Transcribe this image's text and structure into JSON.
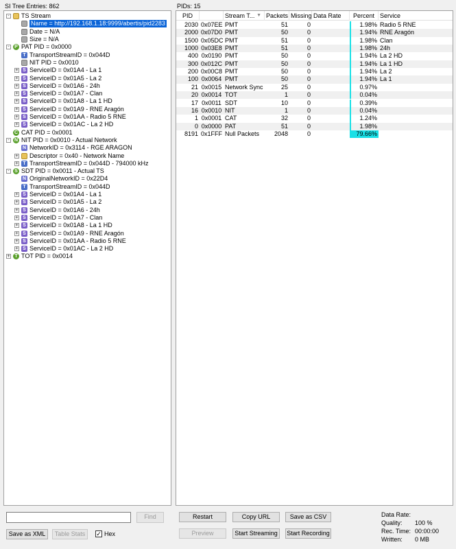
{
  "tree": {
    "header": "SI Tree Entries: 862",
    "nodes": [
      {
        "depth": 0,
        "toggle": "-",
        "icon": "folder",
        "glyph": "",
        "text": "TS Stream"
      },
      {
        "depth": 1,
        "toggle": "",
        "icon": "gray",
        "glyph": "",
        "text": "Name = http://192.168.1.18:9999/abertis/pid2283",
        "selected": true
      },
      {
        "depth": 1,
        "toggle": "",
        "icon": "gray",
        "glyph": "",
        "text": "Date = N/A"
      },
      {
        "depth": 1,
        "toggle": "",
        "icon": "gray",
        "glyph": "",
        "text": "Size = N/A"
      },
      {
        "depth": 0,
        "toggle": "-",
        "icon": "P",
        "glyph": "P",
        "text": "PAT PID = 0x0000"
      },
      {
        "depth": 1,
        "toggle": "",
        "icon": "T",
        "glyph": "T",
        "text": "TransportStreamID = 0x044D"
      },
      {
        "depth": 1,
        "toggle": "",
        "icon": "gray",
        "glyph": "",
        "text": "NIT PID = 0x0010"
      },
      {
        "depth": 1,
        "toggle": "+",
        "icon": "S",
        "glyph": "S",
        "text": "ServiceID = 0x01A4 - La 1"
      },
      {
        "depth": 1,
        "toggle": "+",
        "icon": "S",
        "glyph": "S",
        "text": "ServiceID = 0x01A5 - La 2"
      },
      {
        "depth": 1,
        "toggle": "+",
        "icon": "S",
        "glyph": "S",
        "text": "ServiceID = 0x01A6 - 24h"
      },
      {
        "depth": 1,
        "toggle": "+",
        "icon": "S",
        "glyph": "S",
        "text": "ServiceID = 0x01A7 - Clan"
      },
      {
        "depth": 1,
        "toggle": "+",
        "icon": "S",
        "glyph": "S",
        "text": "ServiceID = 0x01A8 - La 1 HD"
      },
      {
        "depth": 1,
        "toggle": "+",
        "icon": "S",
        "glyph": "S",
        "text": "ServiceID = 0x01A9 - RNE Aragón"
      },
      {
        "depth": 1,
        "toggle": "+",
        "icon": "S",
        "glyph": "S",
        "text": "ServiceID = 0x01AA - Radio 5 RNE"
      },
      {
        "depth": 1,
        "toggle": "+",
        "icon": "S",
        "glyph": "S",
        "text": "ServiceID = 0x01AC - La 2 HD"
      },
      {
        "depth": 0,
        "toggle": "",
        "icon": "C",
        "glyph": "C",
        "text": "CAT PID = 0x0001"
      },
      {
        "depth": 0,
        "toggle": "-",
        "icon": "N2",
        "glyph": "N",
        "text": "NIT PID = 0x0010 - Actual Network"
      },
      {
        "depth": 1,
        "toggle": "",
        "icon": "N",
        "glyph": "N",
        "text": "NetworkID = 0x3114 - RGE ARAGON"
      },
      {
        "depth": 1,
        "toggle": "+",
        "icon": "folder",
        "glyph": "",
        "text": "Descriptor = 0x40 - Network Name"
      },
      {
        "depth": 1,
        "toggle": "+",
        "icon": "T",
        "glyph": "T",
        "text": "TransportStreamID = 0x044D - 794000 kHz"
      },
      {
        "depth": 0,
        "toggle": "-",
        "icon": "S2",
        "glyph": "S",
        "text": "SDT PID = 0x0011 - Actual TS"
      },
      {
        "depth": 1,
        "toggle": "",
        "icon": "N",
        "glyph": "N",
        "text": "OriginalNetworkID = 0x22D4"
      },
      {
        "depth": 1,
        "toggle": "",
        "icon": "T",
        "glyph": "T",
        "text": "TransportStreamID = 0x044D"
      },
      {
        "depth": 1,
        "toggle": "+",
        "icon": "S",
        "glyph": "S",
        "text": "ServiceID = 0x01A4 - La 1"
      },
      {
        "depth": 1,
        "toggle": "+",
        "icon": "S",
        "glyph": "S",
        "text": "ServiceID = 0x01A5 - La 2"
      },
      {
        "depth": 1,
        "toggle": "+",
        "icon": "S",
        "glyph": "S",
        "text": "ServiceID = 0x01A6 - 24h"
      },
      {
        "depth": 1,
        "toggle": "+",
        "icon": "S",
        "glyph": "S",
        "text": "ServiceID = 0x01A7 - Clan"
      },
      {
        "depth": 1,
        "toggle": "+",
        "icon": "S",
        "glyph": "S",
        "text": "ServiceID = 0x01A8 - La 1 HD"
      },
      {
        "depth": 1,
        "toggle": "+",
        "icon": "S",
        "glyph": "S",
        "text": "ServiceID = 0x01A9 - RNE Aragón"
      },
      {
        "depth": 1,
        "toggle": "+",
        "icon": "S",
        "glyph": "S",
        "text": "ServiceID = 0x01AA - Radio 5 RNE"
      },
      {
        "depth": 1,
        "toggle": "+",
        "icon": "S",
        "glyph": "S",
        "text": "ServiceID = 0x01AC - La 2 HD"
      },
      {
        "depth": 0,
        "toggle": "+",
        "icon": "T2",
        "glyph": "T",
        "text": "TOT PID = 0x0014"
      }
    ]
  },
  "pids": {
    "header": "PIDs: 15",
    "columns": [
      "PID",
      "",
      "Stream T...",
      "Packets",
      "Missing",
      "Data Rate",
      "Percent",
      "Service"
    ],
    "rows": [
      {
        "pid": "2030",
        "hex": "0x07EE",
        "type": "PMT",
        "packets": "51",
        "missing": "0",
        "rate": "",
        "percent": "1.98%",
        "pct": 1.98,
        "service": "Radio 5 RNE"
      },
      {
        "pid": "2000",
        "hex": "0x07D0",
        "type": "PMT",
        "packets": "50",
        "missing": "0",
        "rate": "",
        "percent": "1.94%",
        "pct": 1.94,
        "service": "RNE Aragón"
      },
      {
        "pid": "1500",
        "hex": "0x05DC",
        "type": "PMT",
        "packets": "51",
        "missing": "0",
        "rate": "",
        "percent": "1.98%",
        "pct": 1.98,
        "service": "Clan"
      },
      {
        "pid": "1000",
        "hex": "0x03E8",
        "type": "PMT",
        "packets": "51",
        "missing": "0",
        "rate": "",
        "percent": "1.98%",
        "pct": 1.98,
        "service": "24h"
      },
      {
        "pid": "400",
        "hex": "0x0190",
        "type": "PMT",
        "packets": "50",
        "missing": "0",
        "rate": "",
        "percent": "1.94%",
        "pct": 1.94,
        "service": "La 2 HD"
      },
      {
        "pid": "300",
        "hex": "0x012C",
        "type": "PMT",
        "packets": "50",
        "missing": "0",
        "rate": "",
        "percent": "1.94%",
        "pct": 1.94,
        "service": "La 1 HD"
      },
      {
        "pid": "200",
        "hex": "0x00C8",
        "type": "PMT",
        "packets": "50",
        "missing": "0",
        "rate": "",
        "percent": "1.94%",
        "pct": 1.94,
        "service": "La 2"
      },
      {
        "pid": "100",
        "hex": "0x0064",
        "type": "PMT",
        "packets": "50",
        "missing": "0",
        "rate": "",
        "percent": "1.94%",
        "pct": 1.94,
        "service": "La 1"
      },
      {
        "pid": "21",
        "hex": "0x0015",
        "type": "Network Sync",
        "packets": "25",
        "missing": "0",
        "rate": "",
        "percent": "0.97%",
        "pct": 0.97,
        "service": ""
      },
      {
        "pid": "20",
        "hex": "0x0014",
        "type": "TOT",
        "packets": "1",
        "missing": "0",
        "rate": "",
        "percent": "0.04%",
        "pct": 0.04,
        "service": ""
      },
      {
        "pid": "17",
        "hex": "0x0011",
        "type": "SDT",
        "packets": "10",
        "missing": "0",
        "rate": "",
        "percent": "0.39%",
        "pct": 0.39,
        "service": ""
      },
      {
        "pid": "16",
        "hex": "0x0010",
        "type": "NIT",
        "packets": "1",
        "missing": "0",
        "rate": "",
        "percent": "0.04%",
        "pct": 0.04,
        "service": ""
      },
      {
        "pid": "1",
        "hex": "0x0001",
        "type": "CAT",
        "packets": "32",
        "missing": "0",
        "rate": "",
        "percent": "1.24%",
        "pct": 1.24,
        "service": ""
      },
      {
        "pid": "0",
        "hex": "0x0000",
        "type": "PAT",
        "packets": "51",
        "missing": "0",
        "rate": "",
        "percent": "1.98%",
        "pct": 1.98,
        "service": ""
      },
      {
        "pid": "8191",
        "hex": "0x1FFF",
        "type": "Null Packets",
        "packets": "2048",
        "missing": "0",
        "rate": "",
        "percent": "79.66%",
        "pct": 79.66,
        "service": ""
      }
    ]
  },
  "search": {
    "value": "",
    "find_label": "Find"
  },
  "buttons": {
    "save_xml": "Save as XML",
    "table_stats": "Table Stats",
    "hex_label": "Hex",
    "hex_checked": true,
    "restart": "Restart",
    "copy_url": "Copy URL",
    "save_csv": "Save as CSV",
    "preview": "Preview",
    "start_streaming": "Start Streaming",
    "start_recording": "Start Recording"
  },
  "stats": {
    "data_rate_label": "Data Rate:",
    "data_rate_value": "",
    "quality_label": "Quality:",
    "quality_value": "100 %",
    "rec_time_label": "Rec. Time:",
    "rec_time_value": "00:00:00",
    "written_label": "Written:",
    "written_value": "0 MB"
  },
  "colors": {
    "selection": "#0a64d8",
    "percent_bar": "#19e0e6"
  }
}
